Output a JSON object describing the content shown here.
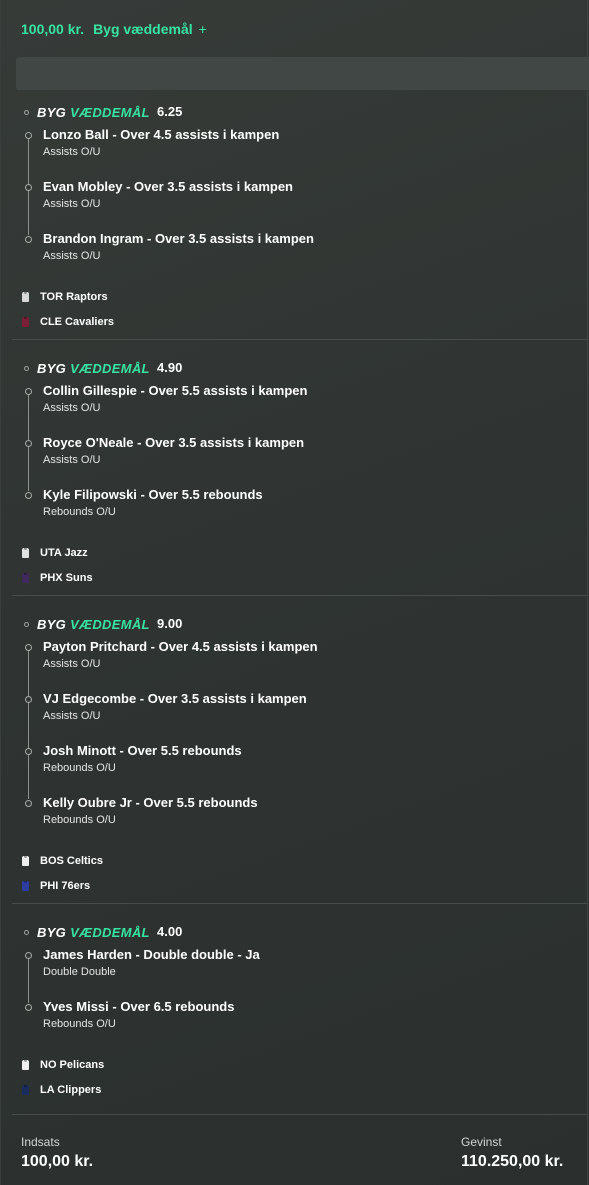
{
  "header": {
    "amount": "100,00 kr.",
    "title": "Byg væddemål",
    "plus": "+"
  },
  "bets": [
    {
      "logo_white": "BYG",
      "logo_green": "VÆDDEMÅL",
      "odds": "6.25",
      "legs": [
        {
          "title": "Lonzo Ball - Over 4.5 assists i kampen",
          "market": "Assists O/U"
        },
        {
          "title": "Evan Mobley - Over 3.5 assists i kampen",
          "market": "Assists O/U"
        },
        {
          "title": "Brandon Ingram - Over 3.5 assists i kampen",
          "market": "Assists O/U"
        }
      ],
      "teams": [
        {
          "name": "TOR Raptors",
          "color": "#d8d8d8",
          "icon": "tor-raptors-jersey-icon"
        },
        {
          "name": "CLE Cavaliers",
          "color": "#7a1f35",
          "icon": "cle-cavaliers-jersey-icon"
        }
      ]
    },
    {
      "logo_white": "BYG",
      "logo_green": "VÆDDEMÅL",
      "odds": "4.90",
      "legs": [
        {
          "title": "Collin Gillespie - Over 5.5 assists i kampen",
          "market": "Assists O/U"
        },
        {
          "title": "Royce O'Neale - Over 3.5 assists i kampen",
          "market": "Assists O/U"
        },
        {
          "title": "Kyle Filipowski - Over 5.5 rebounds",
          "market": "Rebounds O/U"
        }
      ],
      "teams": [
        {
          "name": "UTA Jazz",
          "color": "#e2e2e2",
          "icon": "uta-jazz-jersey-icon"
        },
        {
          "name": "PHX Suns",
          "color": "#3e2a5c",
          "icon": "phx-suns-jersey-icon"
        }
      ]
    },
    {
      "logo_white": "BYG",
      "logo_green": "VÆDDEMÅL",
      "odds": "9.00",
      "legs": [
        {
          "title": "Payton Pritchard - Over 4.5 assists i kampen",
          "market": "Assists O/U"
        },
        {
          "title": "VJ Edgecombe - Over 3.5 assists i kampen",
          "market": "Assists O/U"
        },
        {
          "title": "Josh Minott - Over 5.5 rebounds",
          "market": "Rebounds O/U"
        },
        {
          "title": "Kelly Oubre Jr - Over 5.5 rebounds",
          "market": "Rebounds O/U"
        }
      ],
      "teams": [
        {
          "name": "BOS Celtics",
          "color": "#eeeeee",
          "icon": "bos-celtics-jersey-icon"
        },
        {
          "name": "PHI 76ers",
          "color": "#2c3fa0",
          "icon": "phi-76ers-jersey-icon"
        }
      ]
    },
    {
      "logo_white": "BYG",
      "logo_green": "VÆDDEMÅL",
      "odds": "4.00",
      "legs": [
        {
          "title": "James Harden - Double double - Ja",
          "market": "Double Double"
        },
        {
          "title": "Yves Missi - Over 6.5 rebounds",
          "market": "Rebounds O/U"
        }
      ],
      "teams": [
        {
          "name": "NO Pelicans",
          "color": "#f0f0f0",
          "icon": "no-pelicans-jersey-icon"
        },
        {
          "name": "LA Clippers",
          "color": "#1a2c5c",
          "icon": "la-clippers-jersey-icon"
        }
      ]
    }
  ],
  "footer": {
    "stake_label": "Indsats",
    "stake_value": "100,00 kr.",
    "win_label": "Gevinst",
    "win_value": "110.250,00 kr."
  }
}
